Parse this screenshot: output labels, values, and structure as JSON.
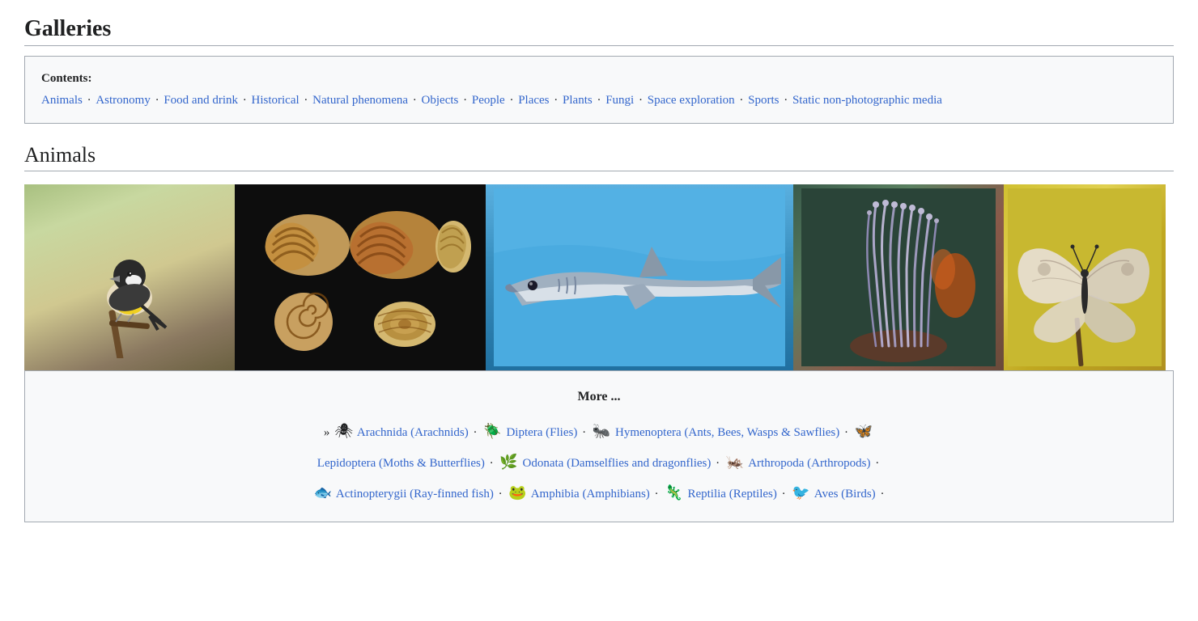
{
  "page": {
    "title": "Galleries"
  },
  "toc": {
    "label": "Contents:",
    "items": [
      {
        "text": "Animals",
        "href": "#animals"
      },
      {
        "text": "Astronomy",
        "href": "#astronomy"
      },
      {
        "text": "Food and drink",
        "href": "#food"
      },
      {
        "text": "Historical",
        "href": "#historical"
      },
      {
        "text": "Natural phenomena",
        "href": "#natural"
      },
      {
        "text": "Objects",
        "href": "#objects"
      },
      {
        "text": "People",
        "href": "#people"
      },
      {
        "text": "Places",
        "href": "#places"
      },
      {
        "text": "Plants",
        "href": "#plants"
      },
      {
        "text": "Fungi",
        "href": "#fungi"
      },
      {
        "text": "Space exploration",
        "href": "#space"
      },
      {
        "text": "Sports",
        "href": "#sports"
      },
      {
        "text": "Static non-photographic media",
        "href": "#static"
      }
    ]
  },
  "animals": {
    "section_title": "Animals",
    "more_title": "More ...",
    "more_arrow": "»",
    "subcategories": [
      {
        "icon": "🕷",
        "text": "Arachnida (Arachnids)"
      },
      {
        "icon": "🪲",
        "text": "Diptera (Flies)"
      },
      {
        "icon": "🐜",
        "text": "Hymenoptera (Ants, Bees, Wasps & Sawflies)"
      },
      {
        "icon": "🦋",
        "text": "Lepidoptera (Moths & Butterflies)"
      },
      {
        "icon": "🌿",
        "text": "Odonata (Damselflies and dragonflies)"
      },
      {
        "icon": "🦗",
        "text": "Arthropoda (Arthropods)"
      },
      {
        "icon": "🐟",
        "text": "Actinopterygii (Ray-finned fish)"
      },
      {
        "icon": "🐸",
        "text": "Amphibia (Amphibians)"
      },
      {
        "icon": "🦎",
        "text": "Reptilia (Reptiles)"
      },
      {
        "icon": "🐦",
        "text": "Aves (Birds)"
      }
    ]
  }
}
